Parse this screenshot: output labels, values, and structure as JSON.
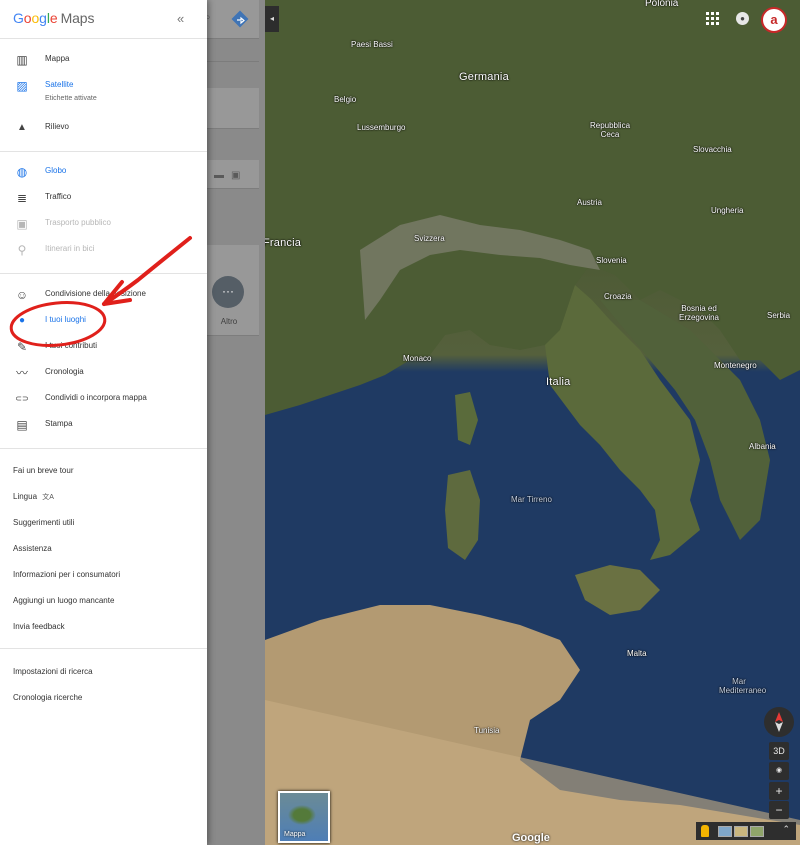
{
  "menu": {
    "logo": {
      "g1": "G",
      "o1": "o",
      "o2": "o",
      "g2": "g",
      "l": "l",
      "e": "e",
      "maps": "Maps"
    },
    "close_icon": "«",
    "map_types": [
      {
        "label": "Mappa",
        "icon": "map-icon",
        "glyph": "▥"
      },
      {
        "label": "Satellite",
        "sublabel": "Etichette attivate",
        "icon": "satellite-icon",
        "glyph": "▨",
        "active": true
      },
      {
        "label": "Rilievo",
        "icon": "terrain-icon",
        "glyph": "▲"
      }
    ],
    "layers": [
      {
        "label": "Globo",
        "icon": "globe-icon",
        "glyph": "◍",
        "active": true
      },
      {
        "label": "Traffico",
        "icon": "traffic-icon",
        "glyph": "≣"
      },
      {
        "label": "Trasporto pubblico",
        "icon": "transit-icon",
        "glyph": "▣",
        "disabled": true
      },
      {
        "label": "Itinerari in bici",
        "icon": "bike-icon",
        "glyph": "⚲",
        "disabled": true
      }
    ],
    "personal": [
      {
        "label": "Condivisione della posizione",
        "icon": "location-sharing-icon",
        "glyph": "☺"
      },
      {
        "label": "I tuoi luoghi",
        "icon": "place-pin-icon",
        "glyph": "●",
        "active": true
      },
      {
        "label": "I tuoi contributi",
        "icon": "contributions-icon",
        "glyph": "✎"
      },
      {
        "label": "Cronologia",
        "icon": "timeline-icon",
        "glyph": "〰"
      },
      {
        "label": "Condividi o incorpora mappa",
        "icon": "link-icon",
        "glyph": "⊂⊃"
      },
      {
        "label": "Stampa",
        "icon": "print-icon",
        "glyph": "▤"
      }
    ],
    "links": [
      "Fai un breve tour",
      "Lingua",
      "Suggerimenti utili",
      "Assistenza",
      "Informazioni per i consumatori",
      "Aggiungi un luogo mancante",
      "Invia feedback"
    ],
    "lingua_icon": "文A",
    "search_links": [
      "Impostazioni di ricerca",
      "Cronologia ricerche"
    ]
  },
  "behind_panel": {
    "more_button": "···",
    "more_label": "Altro",
    "collapse_icon": "◂"
  },
  "map": {
    "countries": [
      {
        "name": "Polonia"
      },
      {
        "name": "Paesi Bassi"
      },
      {
        "name": "Germania"
      },
      {
        "name": "Belgio"
      },
      {
        "name": "Lussemburgo"
      },
      {
        "name": "Repubblica Ceca"
      },
      {
        "name": "Slovacchia"
      },
      {
        "name": "Austria"
      },
      {
        "name": "Ungheria"
      },
      {
        "name": "Svizzera"
      },
      {
        "name": "Francia"
      },
      {
        "name": "Slovenia"
      },
      {
        "name": "Croazia"
      },
      {
        "name": "Bosnia ed Erzegovina"
      },
      {
        "name": "Serbia"
      },
      {
        "name": "Monaco"
      },
      {
        "name": "Italia"
      },
      {
        "name": "Montenegro"
      },
      {
        "name": "Albania"
      },
      {
        "name": "Mar Tirreno"
      },
      {
        "name": "Malta"
      },
      {
        "name": "Mar Mediterraneo"
      },
      {
        "name": "Tunisia"
      }
    ],
    "minimap_label": "Mappa",
    "brand": "Google",
    "controls": {
      "three_d": "3D",
      "locate": "◉",
      "zoom_in": "+",
      "zoom_out": "−",
      "expand": "⌃"
    }
  },
  "header_right": {
    "apps_icon": "apps-grid-icon",
    "notifications_icon": "notifications-icon",
    "avatar_letter": "a"
  },
  "colors": {
    "active": "#1a73e8",
    "annotation": "#e0201b",
    "menu_bg": "#ffffff",
    "avatar_border": "#c62828"
  }
}
